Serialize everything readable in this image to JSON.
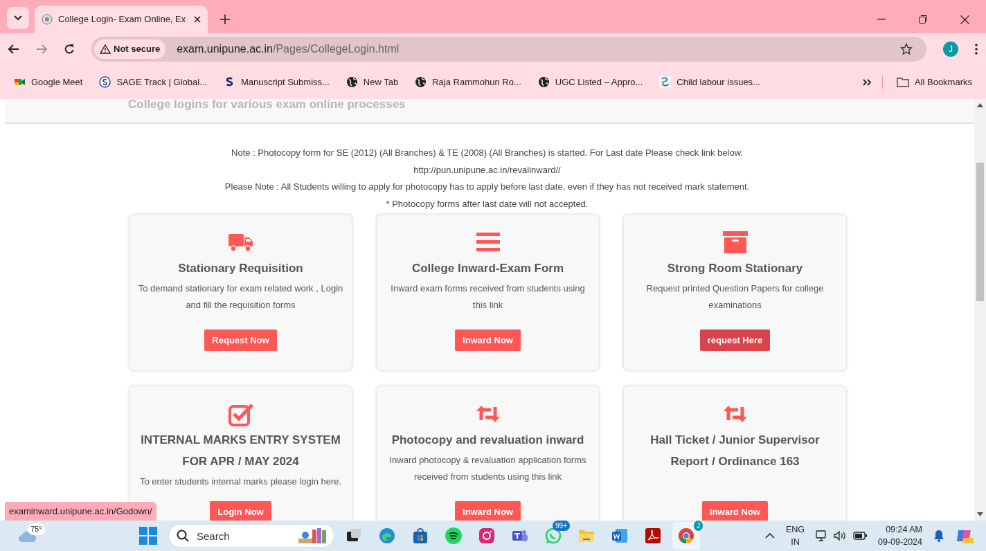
{
  "browser": {
    "tabs": [
      {
        "title": "College Login- Exam Online, Ex",
        "selected": true
      }
    ],
    "address": {
      "security": "Not secure",
      "domain": "exam.unipune.ac.in",
      "path": "/Pages/CollegeLogin.html"
    },
    "avatar": "J",
    "bookmarks": [
      {
        "label": "Google Meet",
        "kind": "meet"
      },
      {
        "label": "SAGE Track | Global...",
        "kind": "sage"
      },
      {
        "label": "Manuscript Submiss...",
        "kind": "s"
      },
      {
        "label": "New Tab",
        "kind": "globe"
      },
      {
        "label": "Raja Rammohun Ro...",
        "kind": "globe"
      },
      {
        "label": "UGC Listed – Appro...",
        "kind": "globe"
      },
      {
        "label": "Child labour issues...",
        "kind": "swirl"
      }
    ],
    "all_bookmarks": "All Bookmarks"
  },
  "page": {
    "header_subtitle": "College logins for various exam online processes",
    "notes": [
      "Note : Photocopy form for SE (2012) (All Branches) & TE (2008) (All Branches) is started. For Last date Please check link below.",
      "http://pun.unipune.ac.in/revalinward//",
      "Please Note : All Students willing to apply for photocopy has to apply before last date, even if they has not received mark statement.",
      "* Photocopy forms after last date will not accepted."
    ],
    "cards": [
      {
        "kind": "truck",
        "title": "Stationary Requisition",
        "description": "To demand stationary for exam related work , Login and fill the requisition forms",
        "button": "Request Now",
        "hovered": false
      },
      {
        "kind": "bars",
        "title": "College Inward-Exam Form",
        "description": "Inward exam forms received from students using this link",
        "button": "Inward Now",
        "hovered": false
      },
      {
        "kind": "archive",
        "title": "Strong Room Stationary",
        "description": "Request printed Question Papers for college examinations",
        "button": "request Here",
        "hovered": true
      },
      {
        "kind": "check",
        "title": "INTERNAL MARKS ENTRY SYSTEM FOR APR / MAY 2024",
        "description": "To enter students internal marks please login here.",
        "button": "Login Now",
        "hovered": false
      },
      {
        "kind": "retweet",
        "title": "Photocopy and revaluation inward",
        "description": "Inward photocopy & revaluation application forms received from students using this link",
        "button": "Inward Now",
        "hovered": false
      },
      {
        "kind": "retweet",
        "title": "Hall Ticket / Junior Supervisor Report / Ordinance 163",
        "button": "Inward Now",
        "hovered": false
      }
    ],
    "status_url": "examinward.unipune.ac.in/Godown/"
  },
  "taskbar": {
    "weather": "75°",
    "search_placeholder": "Search",
    "apps": [
      {
        "kind": "books"
      },
      {
        "kind": "taskview"
      },
      {
        "kind": "edge"
      },
      {
        "kind": "store"
      },
      {
        "kind": "spotify"
      },
      {
        "kind": "instagram"
      },
      {
        "kind": "teams"
      },
      {
        "kind": "whatsapp",
        "badge": "99+"
      },
      {
        "kind": "files"
      },
      {
        "kind": "word"
      },
      {
        "kind": "acrobat"
      },
      {
        "kind": "chrome",
        "badge": "J"
      }
    ],
    "language": [
      "ENG",
      "IN"
    ],
    "time": "09:24 AM",
    "date": "09-09-2024"
  }
}
